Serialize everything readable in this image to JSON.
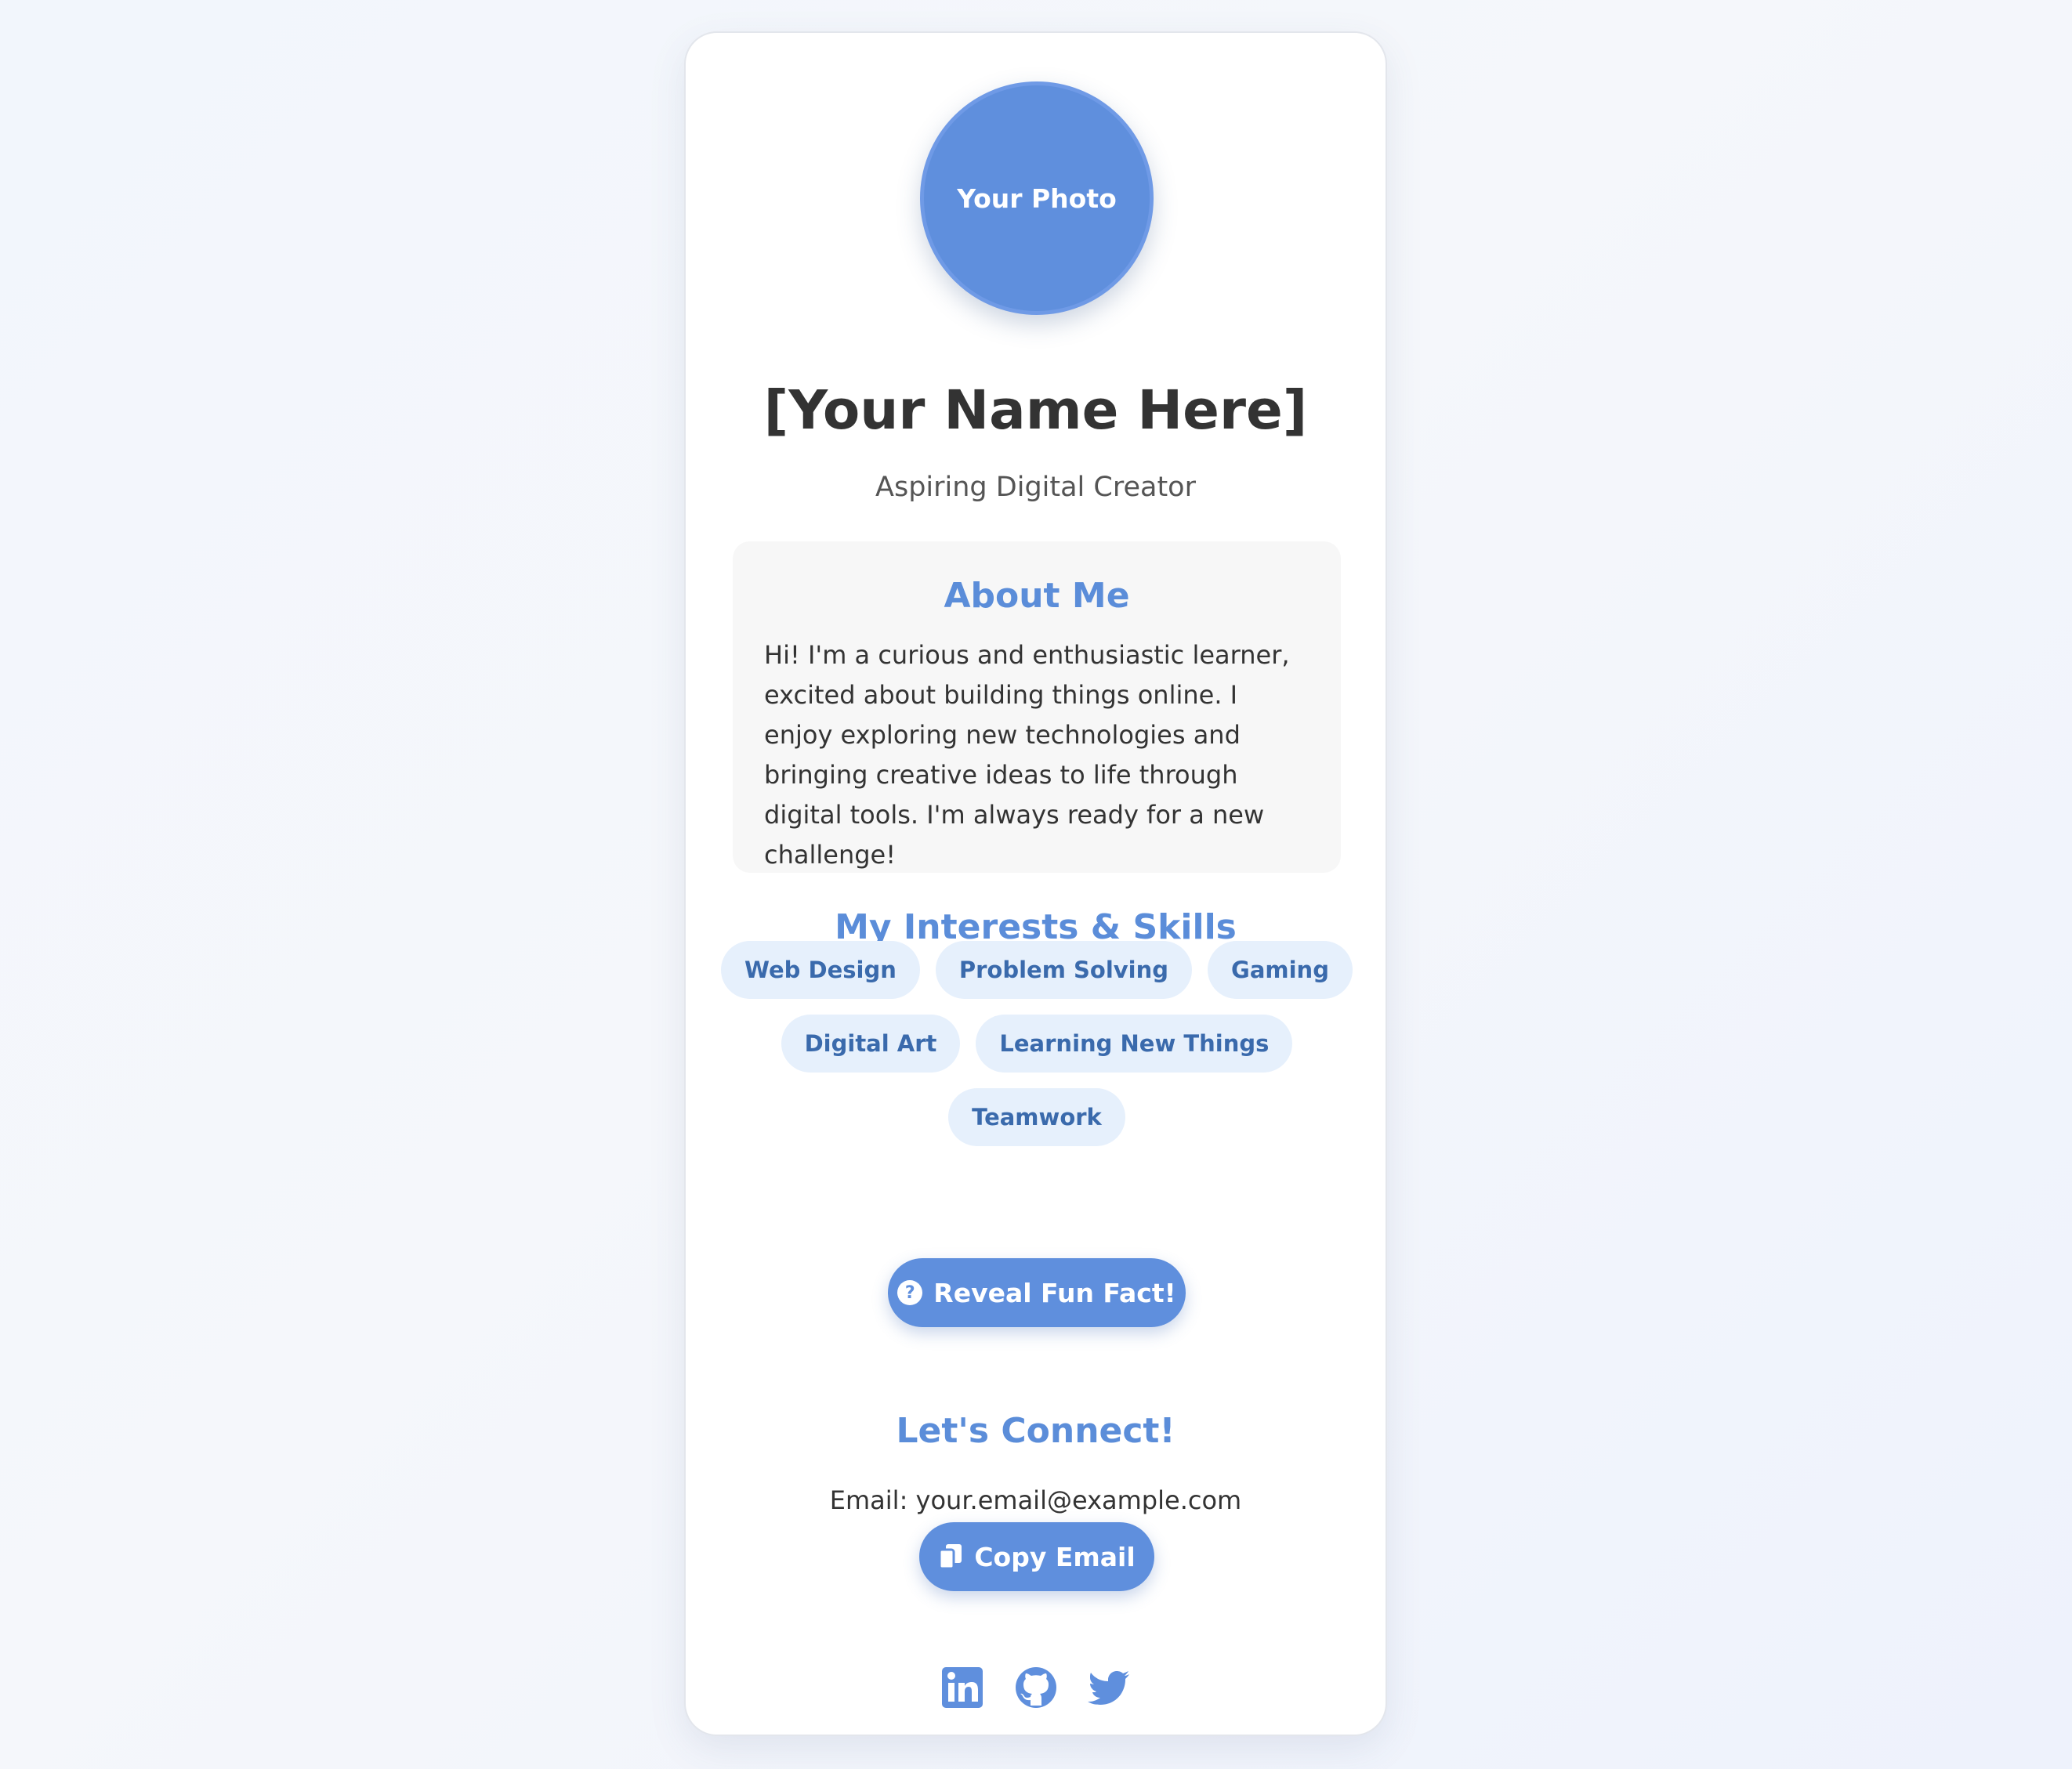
{
  "profile": {
    "photo_label": "Your Photo",
    "name": "[Your Name Here]",
    "tagline": "Aspiring Digital Creator"
  },
  "about": {
    "title": "About Me",
    "text": "Hi! I'm a curious and enthusiastic learner, excited about building things online. I enjoy exploring new technologies and bringing creative ideas to life through digital tools. I'm always ready for a new challenge!"
  },
  "interests": {
    "title": "My Interests & Skills",
    "tags": [
      "Web Design",
      "Problem Solving",
      "Gaming",
      "Digital Art",
      "Learning New Things",
      "Teamwork"
    ]
  },
  "fun_fact": {
    "button_label": "Reveal Fun Fact!",
    "icon": "question-circle-icon"
  },
  "connect": {
    "title": "Let's Connect!",
    "email_text": "Email: your.email@example.com",
    "copy_label": "Copy Email",
    "copy_icon": "copy-icon",
    "socials": [
      "linkedin-icon",
      "github-icon",
      "twitter-icon"
    ]
  },
  "colors": {
    "accent": "#5f8fdd",
    "heading": "#5b8dd9",
    "tag_bg": "#e6f0fc",
    "tag_text": "#3a6aac"
  }
}
